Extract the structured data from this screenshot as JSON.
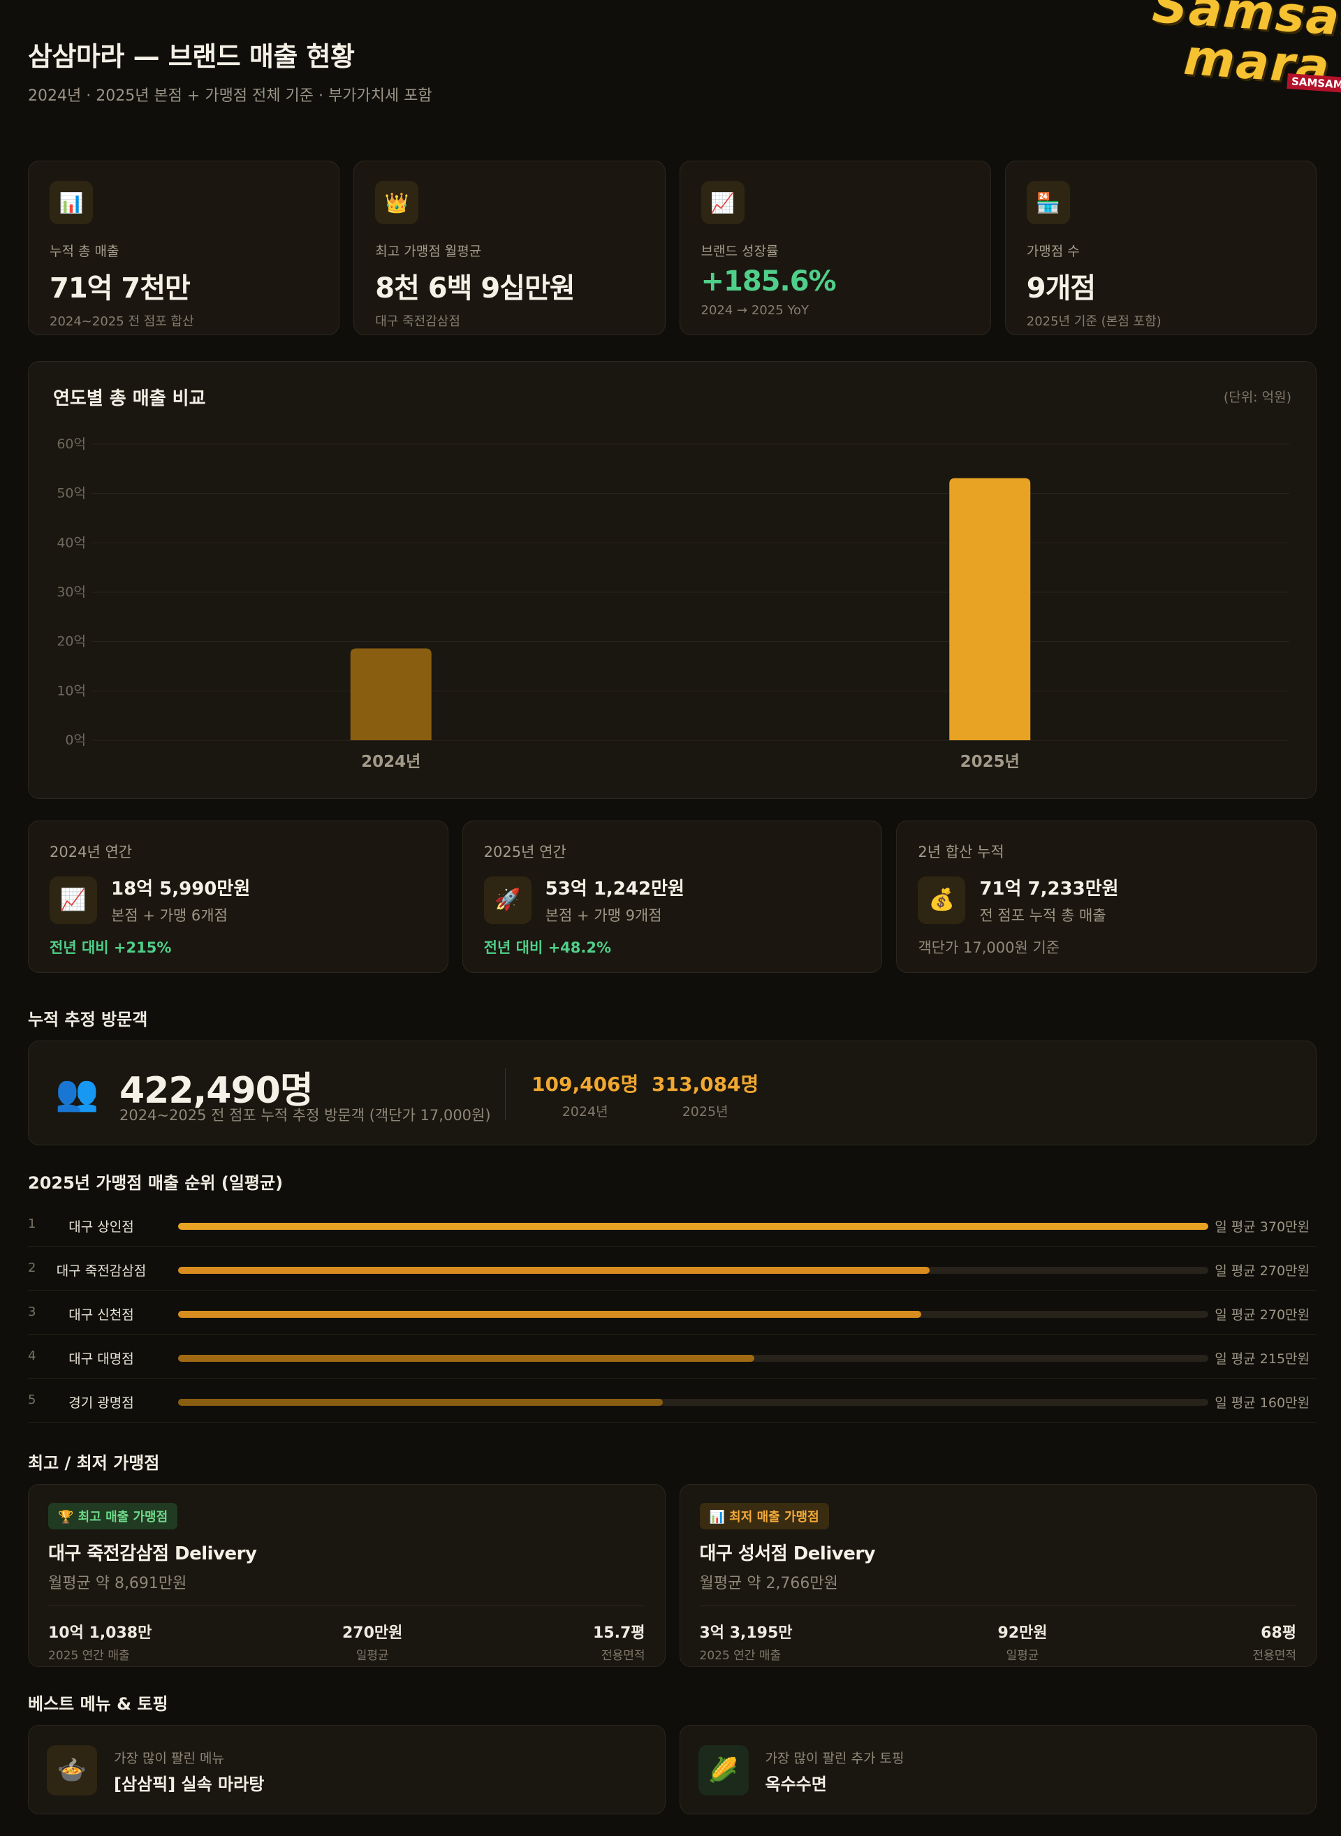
{
  "header": {
    "title": "삼삼마라 — 브랜드 매출 현황",
    "subtitle": "2024년 · 2025년 본점 + 가맹점 전체 기준 · 부가가치세 포함"
  },
  "logo": {
    "line1": "Samsam",
    "line2": "mara",
    "tag": "SAMSAM"
  },
  "kpis": [
    {
      "icon": "📊",
      "icon_name": "bar-chart-icon",
      "label": "누적 총 매출",
      "value": "71억 7천만",
      "note": "2024~2025 전 점포 합산"
    },
    {
      "icon": "👑",
      "icon_name": "crown-icon",
      "label": "최고 가맹점 월평균",
      "value": "8천 6백 9십만원",
      "note": "대구 죽전감삼점"
    },
    {
      "icon": "📈",
      "icon_name": "trend-up-icon",
      "label": "브랜드 성장률",
      "value": "+185.6%",
      "note": "2024 → 2025 YoY"
    },
    {
      "icon": "🏪",
      "icon_name": "store-icon",
      "label": "가맹점 수",
      "value": "9개점",
      "note": "2025년 기준 (본점 포함)"
    }
  ],
  "chart_data": {
    "type": "bar",
    "title": "연도별 총 매출 비교",
    "unit_label": "(단위: 억원)",
    "categories": [
      "2024년",
      "2025년"
    ],
    "values": [
      18.6,
      53.1
    ],
    "colors": [
      "#8a5e10",
      "#e9a324"
    ],
    "ylim": [
      0,
      60
    ],
    "yticks": [
      0,
      10,
      20,
      30,
      40,
      50,
      60
    ],
    "ytick_labels": [
      "0억",
      "10억",
      "20억",
      "30억",
      "40억",
      "50억",
      "60억"
    ],
    "grid": true
  },
  "years": [
    {
      "label": "2024년 연간",
      "icon": "📈",
      "icon_name": "trend-up-icon",
      "amount": "18억 5,990만원",
      "detail": "본점 + 가맹 6개점",
      "foot": "전년 대비 +215%"
    },
    {
      "label": "2025년 연간",
      "icon": "🚀",
      "icon_name": "rocket-icon",
      "amount": "53억 1,242만원",
      "detail": "본점 + 가맹 9개점",
      "foot": "전년 대비 +48.2%"
    },
    {
      "label": "2년 합산 누적",
      "icon": "💰",
      "icon_name": "money-bag-icon",
      "amount": "71억 7,233만원",
      "detail": "전 점포 누적 총 매출",
      "foot": "객단가 17,000원 기준"
    }
  ],
  "visitors": {
    "section_title": "누적 추정 방문객",
    "icon": "👥",
    "total": "422,490명",
    "desc": "2024~2025 전 점포 누적 추정 방문객 (객단가 17,000원)",
    "y2024": {
      "value": "109,406명",
      "label": "2024년"
    },
    "y2025": {
      "value": "313,084명",
      "label": "2025년"
    }
  },
  "ranking": {
    "section_title": "2025년 가맹점 매출 순위 (일평균)",
    "items": [
      {
        "rank": "1",
        "name": "대구 상인점",
        "value_label": "일 평균 370만원",
        "value": 370,
        "color": "#e9a324"
      },
      {
        "rank": "2",
        "name": "대구 죽전감삼점",
        "value_label": "일 평균 270만원",
        "value": 270,
        "color": "#d98d1e"
      },
      {
        "rank": "3",
        "name": "대구 신천점",
        "value_label": "일 평균 270만원",
        "value": 267,
        "color": "#d98d1e"
      },
      {
        "rank": "4",
        "name": "대구 대명점",
        "value_label": "일 평균 215만원",
        "value": 207,
        "color": "#a06a14"
      },
      {
        "rank": "5",
        "name": "경기 광명점",
        "value_label": "일 평균 160만원",
        "value": 174,
        "color": "#8a5e10"
      }
    ]
  },
  "bestworst": {
    "section_title": "최고 / 최저 가맹점",
    "best": {
      "badge": "🏆 최고 매출 가맹점",
      "title": "대구 죽전감삼점 Delivery",
      "avg": "월평균 약 8,691만원",
      "stats": [
        {
          "v": "10억 1,038만",
          "l": "2025 연간 매출"
        },
        {
          "v": "270만원",
          "l": "일평균"
        },
        {
          "v": "15.7평",
          "l": "전용면적"
        }
      ]
    },
    "worst": {
      "badge": "📊 최저 매출 가맹점",
      "title": "대구 성서점 Delivery",
      "avg": "월평균 약 2,766만원",
      "stats": [
        {
          "v": "3억 3,195만",
          "l": "2025 연간 매출"
        },
        {
          "v": "92만원",
          "l": "일평균"
        },
        {
          "v": "68평",
          "l": "전용면적"
        }
      ]
    }
  },
  "menu": {
    "section_title": "베스트 메뉴 & 토핑",
    "best_menu": {
      "icon": "🍲",
      "label": "가장 많이 팔린 메뉴",
      "value": "[삼삼픽] 실속 마라탕"
    },
    "best_topping": {
      "icon": "🌽",
      "label": "가장 많이 팔린 추가 토핑",
      "value": "옥수수면"
    }
  }
}
